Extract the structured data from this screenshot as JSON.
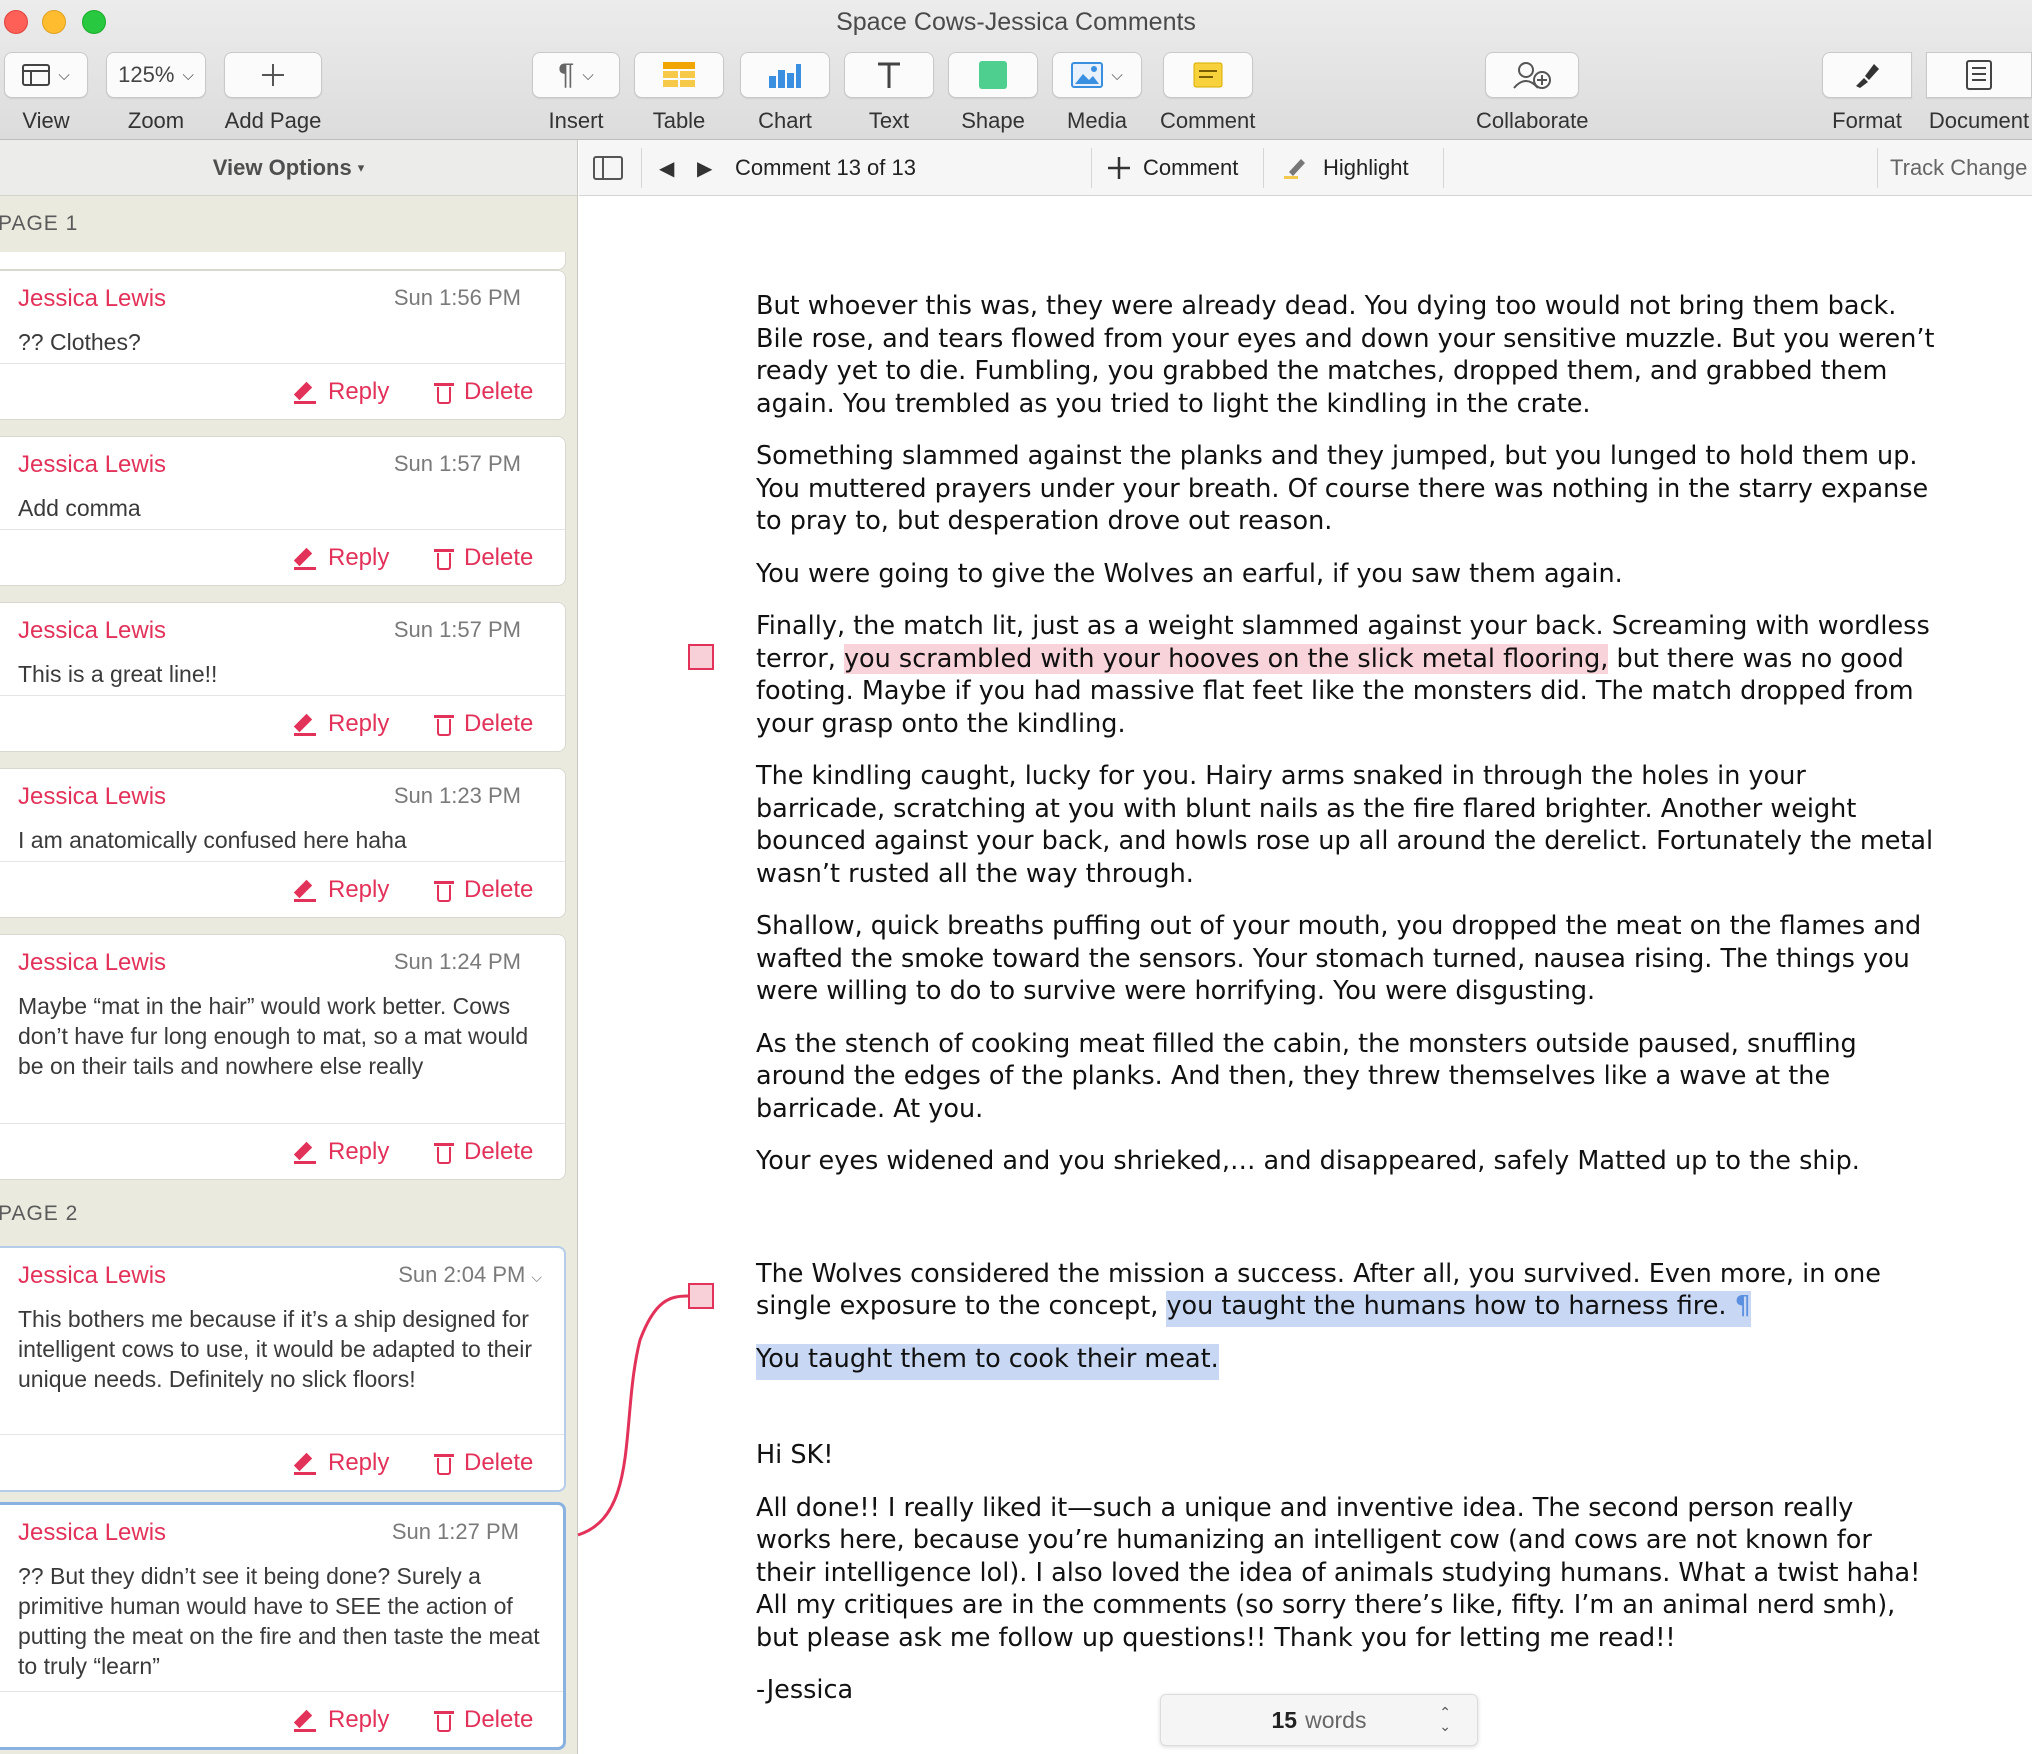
{
  "window": {
    "title": "Space Cows-Jessica Comments"
  },
  "toolbar": {
    "view": "View",
    "zoom": "Zoom",
    "zoom_value": "125%",
    "add_page": "Add Page",
    "insert": "Insert",
    "table": "Table",
    "chart": "Chart",
    "text": "Text",
    "shape": "Shape",
    "media": "Media",
    "comment": "Comment",
    "collaborate": "Collaborate",
    "format": "Format",
    "document": "Document"
  },
  "sidebar": {
    "header": "View Options",
    "page1_label": "PAGE 1",
    "page2_label": "PAGE 2",
    "reply_label": "Reply",
    "delete_label": "Delete",
    "comments": [
      {
        "author": "Jessica Lewis",
        "time": "Sun 1:56 PM",
        "body": "?? Clothes?"
      },
      {
        "author": "Jessica Lewis",
        "time": "Sun 1:57 PM",
        "body": "Add comma"
      },
      {
        "author": "Jessica Lewis",
        "time": "Sun 1:57 PM",
        "body": "This is a great line!!"
      },
      {
        "author": "Jessica Lewis",
        "time": "Sun 1:23 PM",
        "body": "I am anatomically confused here haha"
      },
      {
        "author": "Jessica Lewis",
        "time": "Sun 1:24 PM",
        "body": "Maybe “mat in the hair” would work better. Cows don’t have fur long enough to mat, so a mat would be on their tails and nowhere else really"
      },
      {
        "author": "Jessica Lewis",
        "time": "Sun 2:04 PM",
        "body": "This bothers me because if it’s a ship designed for intelligent cows to use, it would be adapted to their unique needs. Definitely no slick floors!"
      },
      {
        "author": "Jessica Lewis",
        "time": "Sun 1:27 PM",
        "body": "?? But they didn’t see it being done? Surely a primitive human would have to SEE the action of putting the meat on the fire and then taste the meat to truly “learn”"
      }
    ]
  },
  "doc_toolbar": {
    "nav": "Comment 13 of 13",
    "add_comment": "Comment",
    "highlight": "Highlight",
    "track_changes": "Track Change"
  },
  "document": {
    "p1": "But whoever this was, they were already dead. You dying too would not bring them back. Bile rose, and tears flowed from your eyes and down your sensitive muzzle. But you weren’t ready yet to die. Fumbling, you grabbed the matches, dropped them, and grabbed them again. You trembled as you tried to light the kindling in the crate.",
    "p2": "Something slammed against the planks and they jumped, but you lunged to hold them up. You muttered prayers under your breath. Of course there was nothing in the starry expanse to pray to, but desperation drove out reason.",
    "p3": "You were going to give the Wolves an earful, if you saw them again.",
    "p4_a": "Finally, the match lit, just as a weight slammed against your back. Screaming with wordless terror,",
    "p4_hl": "you scrambled with your hooves on the slick metal flooring,",
    "p4_b": "but there was no good footing. Maybe if you had massive flat feet like the monsters did. The match dropped from your grasp onto the kindling.",
    "p5": "The kindling caught, lucky for you. Hairy arms snaked in through the holes in your barricade, scratching at you with blunt nails as the fire flared brighter. Another weight bounced against your back, and howls rose up all around the derelict. Fortunately the metal wasn’t rusted all the way through.",
    "p6": "Shallow, quick breaths puffing out of your mouth, you dropped the meat on the flames and wafted the smoke toward the sensors. Your stomach turned, nausea rising. The things you were willing to do to survive were horrifying. You were disgusting.",
    "p7": "As the stench of cooking meat filled the cabin, the monsters outside paused, snuffling around the edges of the planks. And then, they threw themselves like a wave at the barricade. At you.",
    "p8": "Your eyes widened and you shrieked,… and disappeared, safely Matted up to the ship.",
    "p9_a": "The Wolves considered the mission a success. After all, you survived. Even more, in one single exposure to the concept,",
    "p9_hl": "you taught the humans how to harness fire.",
    "p9_mark": "¶",
    "p10_hl": "You taught them to cook their meat.",
    "p11": "Hi SK!",
    "p12": "All done!! I really liked it—such a unique and inventive idea. The second person really works here, because you’re humanizing an intelligent cow (and cows are not known for their intelligence lol). I also loved the idea of animals studying humans. What a twist haha!  All my critiques are in the comments (so sorry there’s like, fifty. I’m an animal nerd smh), but please ask me follow up questions!! Thank you for letting me read!!",
    "p13": "-Jessica"
  },
  "word_count": {
    "count": "15",
    "label": "words"
  },
  "colors": {
    "accent": "#e3325a",
    "pink_highlight": "#f8d3da",
    "blue_highlight": "#c8d8f4",
    "selection_border": "#8ab2e0"
  }
}
